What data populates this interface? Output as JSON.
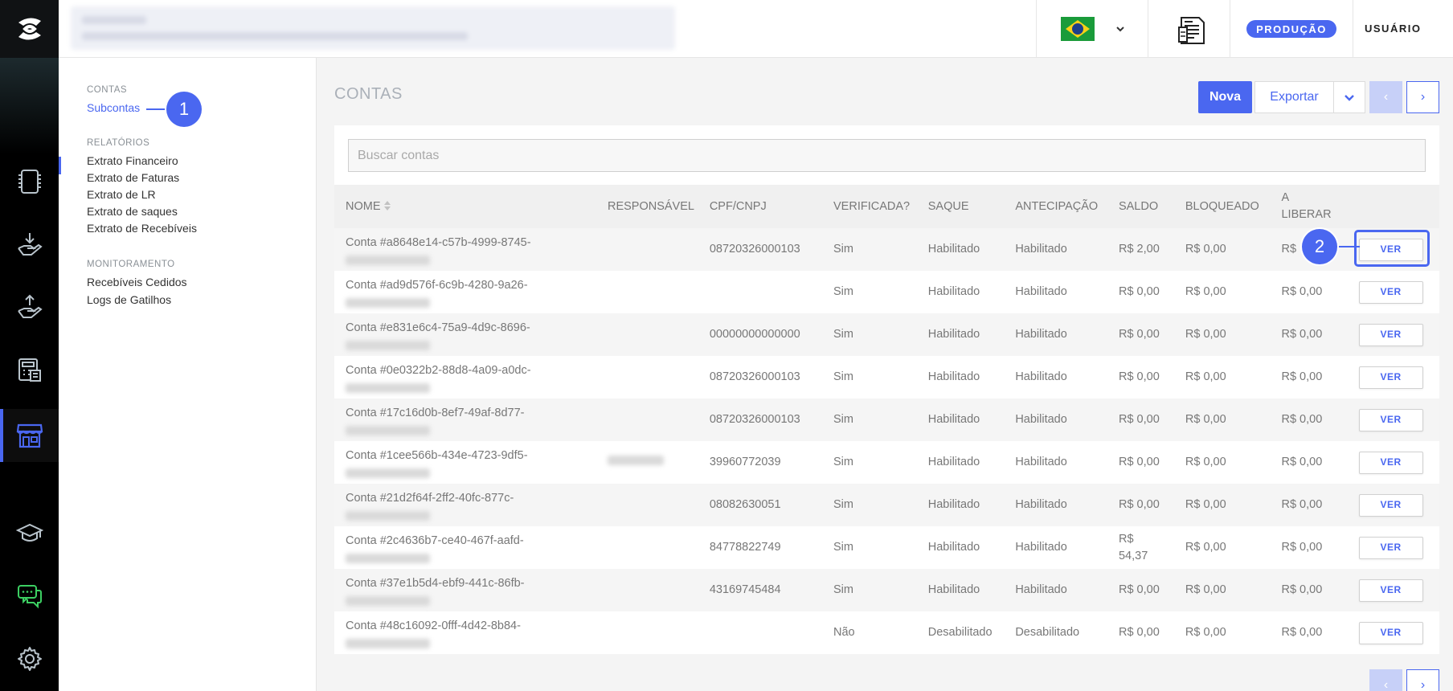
{
  "header": {
    "environment_badge": "PRODUÇÃO",
    "user_label": "USUÁRIO"
  },
  "subnav": {
    "sections": [
      {
        "title": "CONTAS",
        "items": [
          "Subcontas"
        ]
      },
      {
        "title": "RELATÓRIOS",
        "items": [
          "Extrato Financeiro",
          "Extrato de Faturas",
          "Extrato de LR",
          "Extrato de saques",
          "Extrato de Recebíveis"
        ]
      },
      {
        "title": "MONITORAMENTO",
        "items": [
          "Recebíveis Cedidos",
          "Logs de Gatilhos"
        ]
      }
    ],
    "active_item": "Subcontas"
  },
  "callouts": {
    "first": "1",
    "second": "2"
  },
  "main": {
    "title": "CONTAS",
    "new_label": "Nova",
    "export_label": "Exportar",
    "prev_label": "‹",
    "next_label": "›",
    "search_placeholder": "Buscar contas"
  },
  "table": {
    "columns": [
      "NOME",
      "RESPONSÁVEL",
      "CPF/CNPJ",
      "VERIFICADA?",
      "SAQUE",
      "ANTECIPAÇÃO",
      "SALDO",
      "BLOQUEADO",
      "A LIBERAR"
    ],
    "action_label": "VER",
    "rows": [
      {
        "nome": "Conta #a8648e14-c57b-4999-8745-",
        "cpf": "08720326000103",
        "verificada": "Sim",
        "saque": "Habilitado",
        "antecipacao": "Habilitado",
        "saldo": "R$ 2,00",
        "bloqueado": "R$ 0,00",
        "liberar": "R$"
      },
      {
        "nome": "Conta #ad9d576f-6c9b-4280-9a26-",
        "cpf": "",
        "verificada": "Sim",
        "saque": "Habilitado",
        "antecipacao": "Habilitado",
        "saldo": "R$ 0,00",
        "bloqueado": "R$ 0,00",
        "liberar": "R$ 0,00"
      },
      {
        "nome": "Conta #e831e6c4-75a9-4d9c-8696-",
        "cpf": "00000000000000",
        "verificada": "Sim",
        "saque": "Habilitado",
        "antecipacao": "Habilitado",
        "saldo": "R$ 0,00",
        "bloqueado": "R$ 0,00",
        "liberar": "R$ 0,00"
      },
      {
        "nome": "Conta #0e0322b2-88d8-4a09-a0dc-",
        "cpf": "08720326000103",
        "verificada": "Sim",
        "saque": "Habilitado",
        "antecipacao": "Habilitado",
        "saldo": "R$ 0,00",
        "bloqueado": "R$ 0,00",
        "liberar": "R$ 0,00"
      },
      {
        "nome": "Conta #17c16d0b-8ef7-49af-8d77-",
        "cpf": "08720326000103",
        "verificada": "Sim",
        "saque": "Habilitado",
        "antecipacao": "Habilitado",
        "saldo": "R$ 0,00",
        "bloqueado": "R$ 0,00",
        "liberar": "R$ 0,00"
      },
      {
        "nome": "Conta #1cee566b-434e-4723-9df5-",
        "cpf": "39960772039",
        "verificada": "Sim",
        "saque": "Habilitado",
        "antecipacao": "Habilitado",
        "saldo": "R$ 0,00",
        "bloqueado": "R$ 0,00",
        "liberar": "R$ 0,00"
      },
      {
        "nome": "Conta #21d2f64f-2ff2-40fc-877c-",
        "cpf": "08082630051",
        "verificada": "Sim",
        "saque": "Habilitado",
        "antecipacao": "Habilitado",
        "saldo": "R$ 0,00",
        "bloqueado": "R$ 0,00",
        "liberar": "R$ 0,00"
      },
      {
        "nome": "Conta #2c4636b7-ce40-467f-aafd-",
        "cpf": "84778822749",
        "verificada": "Sim",
        "saque": "Habilitado",
        "antecipacao": "Habilitado",
        "saldo": "R$ 54,37",
        "bloqueado": "R$ 0,00",
        "liberar": "R$ 0,00"
      },
      {
        "nome": "Conta #37e1b5d4-ebf9-441c-86fb-",
        "cpf": "43169745484",
        "verificada": "Sim",
        "saque": "Habilitado",
        "antecipacao": "Habilitado",
        "saldo": "R$ 0,00",
        "bloqueado": "R$ 0,00",
        "liberar": "R$ 0,00"
      },
      {
        "nome": "Conta #48c16092-0fff-4d42-8b84-",
        "cpf": "",
        "verificada": "Não",
        "saque": "Desabilitado",
        "antecipacao": "Desabilitado",
        "saldo": "R$ 0,00",
        "bloqueado": "R$ 0,00",
        "liberar": "R$ 0,00"
      }
    ]
  },
  "colors": {
    "accent": "#4a67f0",
    "rail": "#000000",
    "disabled_page": "#c7d0f8"
  },
  "icons": [
    "app-logo-icon",
    "chip-icon",
    "hand-receive-icon",
    "hand-send-icon",
    "calculator-icon",
    "store-icon",
    "graduation-cap-icon",
    "chat-icon",
    "gear-icon",
    "brazil-flag-icon",
    "chevron-down-icon",
    "report-document-icon",
    "sort-icon"
  ]
}
